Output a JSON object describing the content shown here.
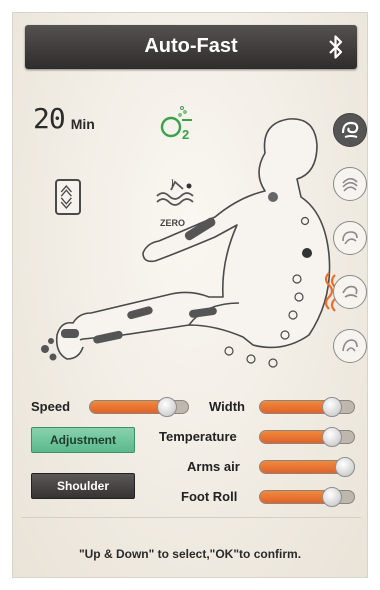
{
  "header": {
    "title": "Auto-Fast",
    "bluetooth_icon": "bluetooth-icon"
  },
  "timer": {
    "value": "20",
    "unit": "Min"
  },
  "oxygen_icon": "o2-icon",
  "zero_gravity": {
    "label": "ZERO",
    "icon": "zero-gravity-icon"
  },
  "tilt_icon": "tilt-updown-icon",
  "mode_buttons": [
    "massage-mode-1-icon",
    "massage-mode-2-icon",
    "massage-mode-3-icon",
    "massage-mode-4-icon",
    "massage-mode-5-icon"
  ],
  "controls": {
    "speed": {
      "label": "Speed",
      "level": 0.78
    },
    "width": {
      "label": "Width",
      "level": 0.76
    },
    "temperature": {
      "label": "Temperature",
      "level": 0.76
    },
    "arms_air": {
      "label": "Arms air",
      "level": 0.94
    },
    "foot_roll": {
      "label": "Foot Roll",
      "level": 0.76
    }
  },
  "buttons": {
    "adjustment": "Adjustment",
    "shoulder": "Shoulder"
  },
  "hint": "\"Up &  Down\" to select,\"OK\"to confirm.",
  "colors": {
    "accent_orange": "#e8702f",
    "active_green": "#6cc59a",
    "dark_button": "#3f3b3b"
  }
}
